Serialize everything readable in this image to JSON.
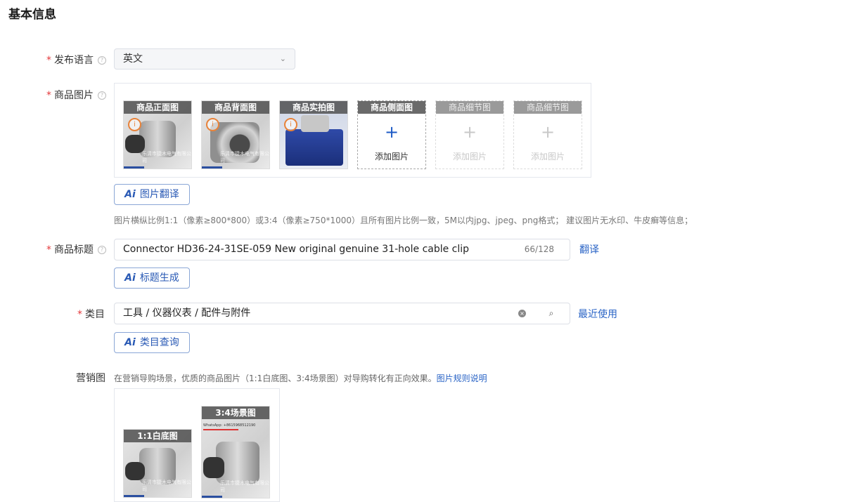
{
  "section": {
    "title": "基本信息"
  },
  "language": {
    "label": "发布语言",
    "value": "英文"
  },
  "images": {
    "label": "商品图片",
    "slots": [
      {
        "caption": "商品正面图",
        "watermark": "乐清市捷木电气有限公司"
      },
      {
        "caption": "商品背面图",
        "watermark": "乐清市捷木电气有限公司"
      },
      {
        "caption": "商品实拍图"
      },
      {
        "caption": "商品侧面图",
        "add_label": "添加图片"
      },
      {
        "caption": "商品细节图",
        "add_label": "添加图片"
      },
      {
        "caption": "商品细节图",
        "add_label": "添加图片"
      }
    ],
    "translate_button": "图片翻译",
    "hint": "图片横纵比例1:1（像素≥800*800）或3:4（像素≥750*1000）且所有图片比例一致，5M以内jpg、jpeg、png格式； 建议图片无水印、牛皮癣等信息；"
  },
  "title_field": {
    "label": "商品标题",
    "value": "Connector HD36-24-31SE-059 New original genuine 31-hole cable clip",
    "count": "66/128",
    "translate_link": "翻译",
    "generate_button": "标题生成"
  },
  "category": {
    "label": "类目",
    "value": "工具 / 仪器仪表 / 配件与附件",
    "recent_link": "最近使用",
    "query_button": "类目查询"
  },
  "marketing": {
    "label": "营销图",
    "hint": "在营销导购场景，优质的商品图片（1:1白底图、3:4场景图）对导购转化有正向效果。",
    "rules_link": "图片规则说明",
    "white_caption": "1:1白底图",
    "scene_caption": "3:4场景图",
    "watermark": "乐清市捷木电气有限公司",
    "scene_header": "WhatsApp: +8615968512190"
  },
  "colors": {
    "accent": "#2a64c6",
    "required": "#e4393c"
  }
}
